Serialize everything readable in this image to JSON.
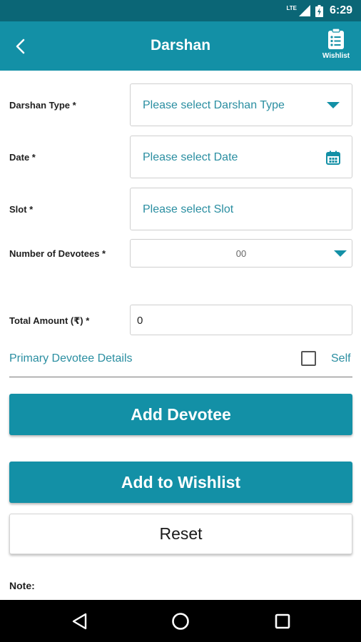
{
  "status_bar": {
    "network": "LTE",
    "time": "6:29"
  },
  "app_bar": {
    "title": "Darshan",
    "wishlist_label": "Wishlist"
  },
  "form": {
    "darshan_type": {
      "label": "Darshan Type *",
      "placeholder": "Please select Darshan Type"
    },
    "date": {
      "label": "Date *",
      "placeholder": "Please select Date"
    },
    "slot": {
      "label": "Slot *",
      "placeholder": "Please select Slot"
    },
    "devotees": {
      "label": "Number of Devotees *",
      "value": "00"
    },
    "total_amount": {
      "label": "Total Amount (₹) *",
      "value": "0"
    }
  },
  "primary_devotee": {
    "title": "Primary Devotee Details",
    "self_label": "Self",
    "self_checked": false
  },
  "buttons": {
    "add_devotee": "Add Devotee",
    "add_to_wishlist": "Add to Wishlist",
    "reset": "Reset"
  },
  "note_label": "Note:",
  "colors": {
    "status_bar": "#0b6676",
    "app_bar": "#1390a6",
    "accent_text": "#2a8ea1"
  },
  "icons": {
    "back": "chevron-left-icon",
    "wishlist": "wishlist-clipboard-icon",
    "calendar": "calendar-icon",
    "dropdown": "triangle-down-icon"
  }
}
